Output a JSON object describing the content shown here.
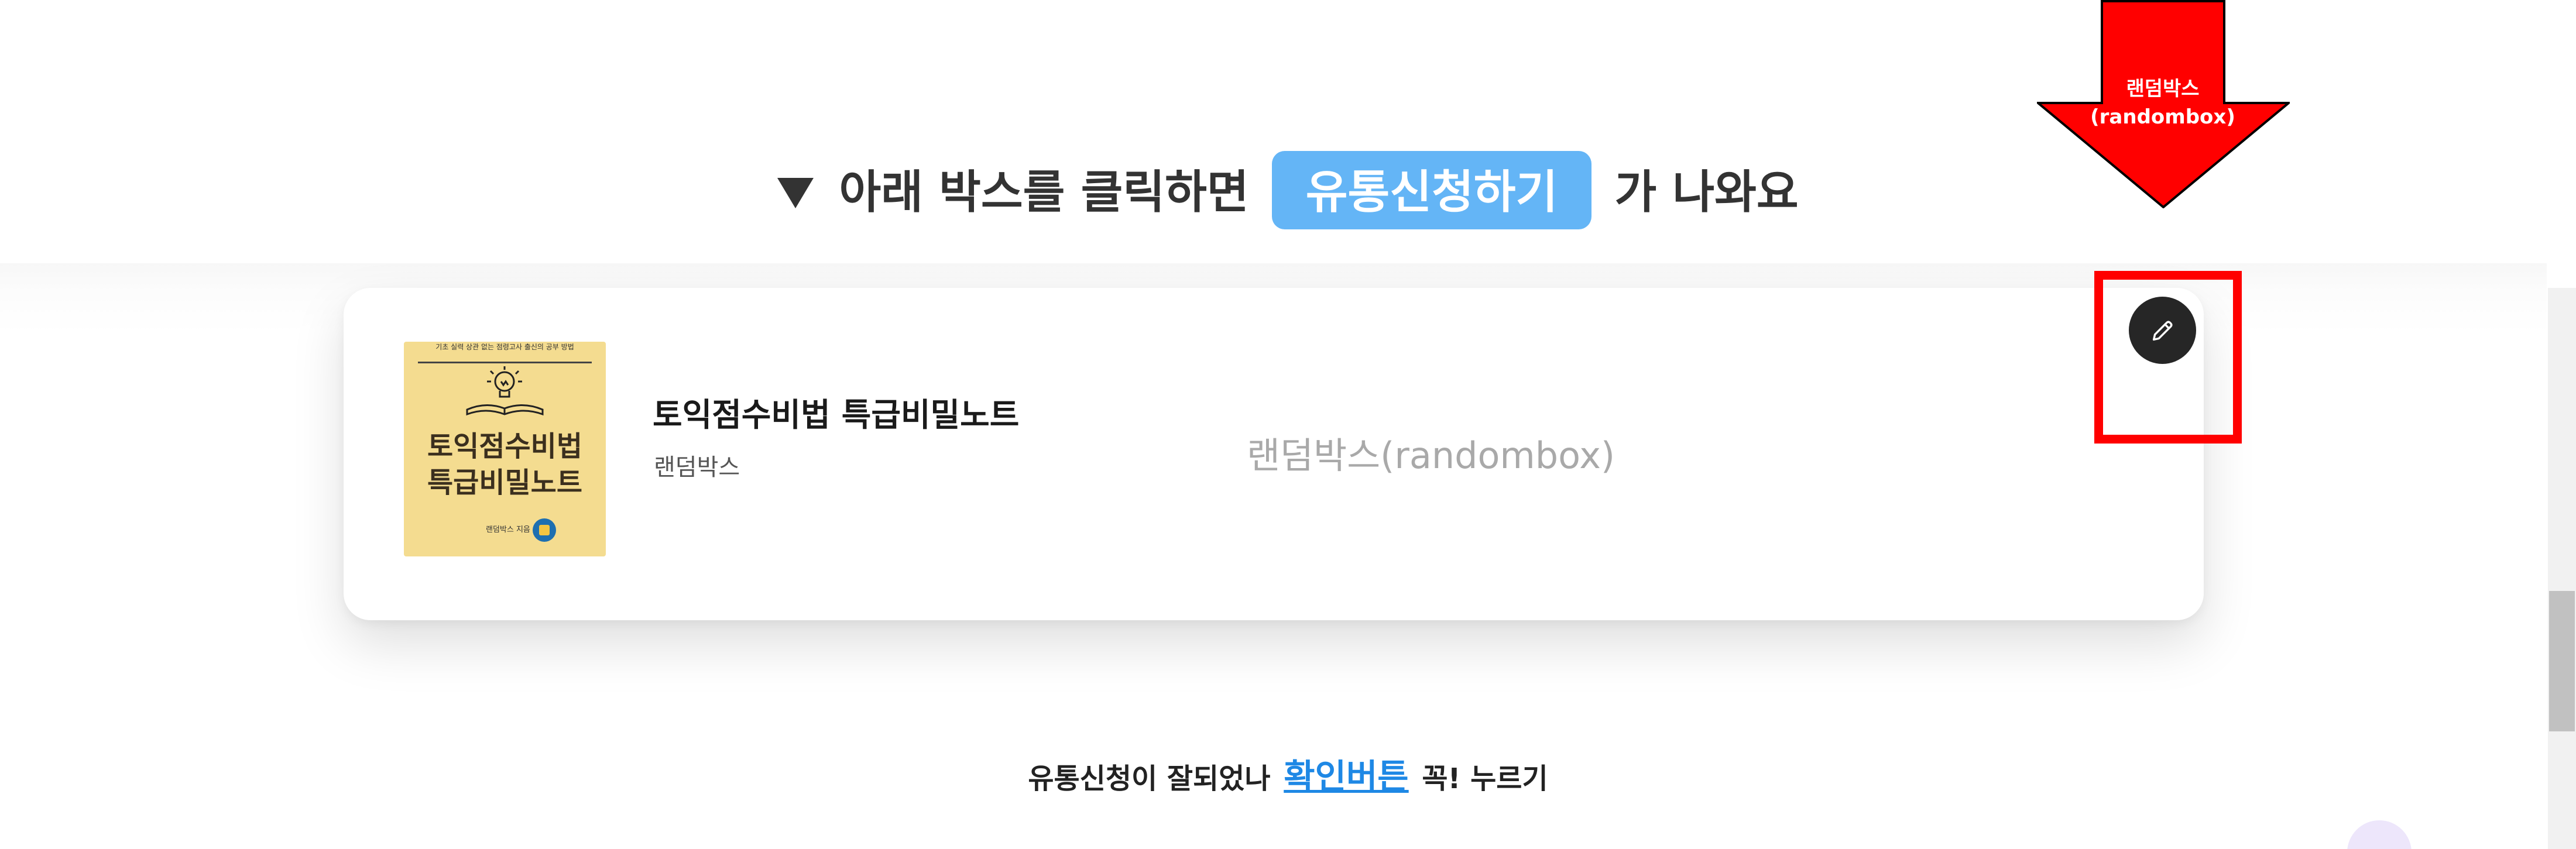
{
  "heading": {
    "before": "아래 박스를 클릭하면",
    "highlight": "유통신청하기",
    "after": "가 나와요"
  },
  "card": {
    "cover": {
      "top_line": "기초 실력 상관 없는 점령고사 출신의 공부 방법",
      "title_line1": "토익점수비법",
      "title_line2": "특급비밀노트",
      "publisher": "랜덤박스 지음"
    },
    "title": "토익점수비법 특급비밀노트",
    "author": "랜덤박스",
    "watermark": "랜덤박스(randombox)"
  },
  "callout": {
    "line1": "랜덤박스",
    "line2": "(randombox)"
  },
  "bottom_note": {
    "before": "유통신청이 잘되었나",
    "link": "확인버튼",
    "after": "꼭! 누르기"
  },
  "colors": {
    "highlight_bg": "#64b5f6",
    "callout_red": "#ff0000",
    "link_blue": "#1e88e5",
    "edit_button": "#262626",
    "cover_bg": "#f4dc90"
  },
  "icons": {
    "heading_marker": "triangle-down-icon",
    "edit": "pencil-icon",
    "callout": "arrow-down-icon"
  }
}
